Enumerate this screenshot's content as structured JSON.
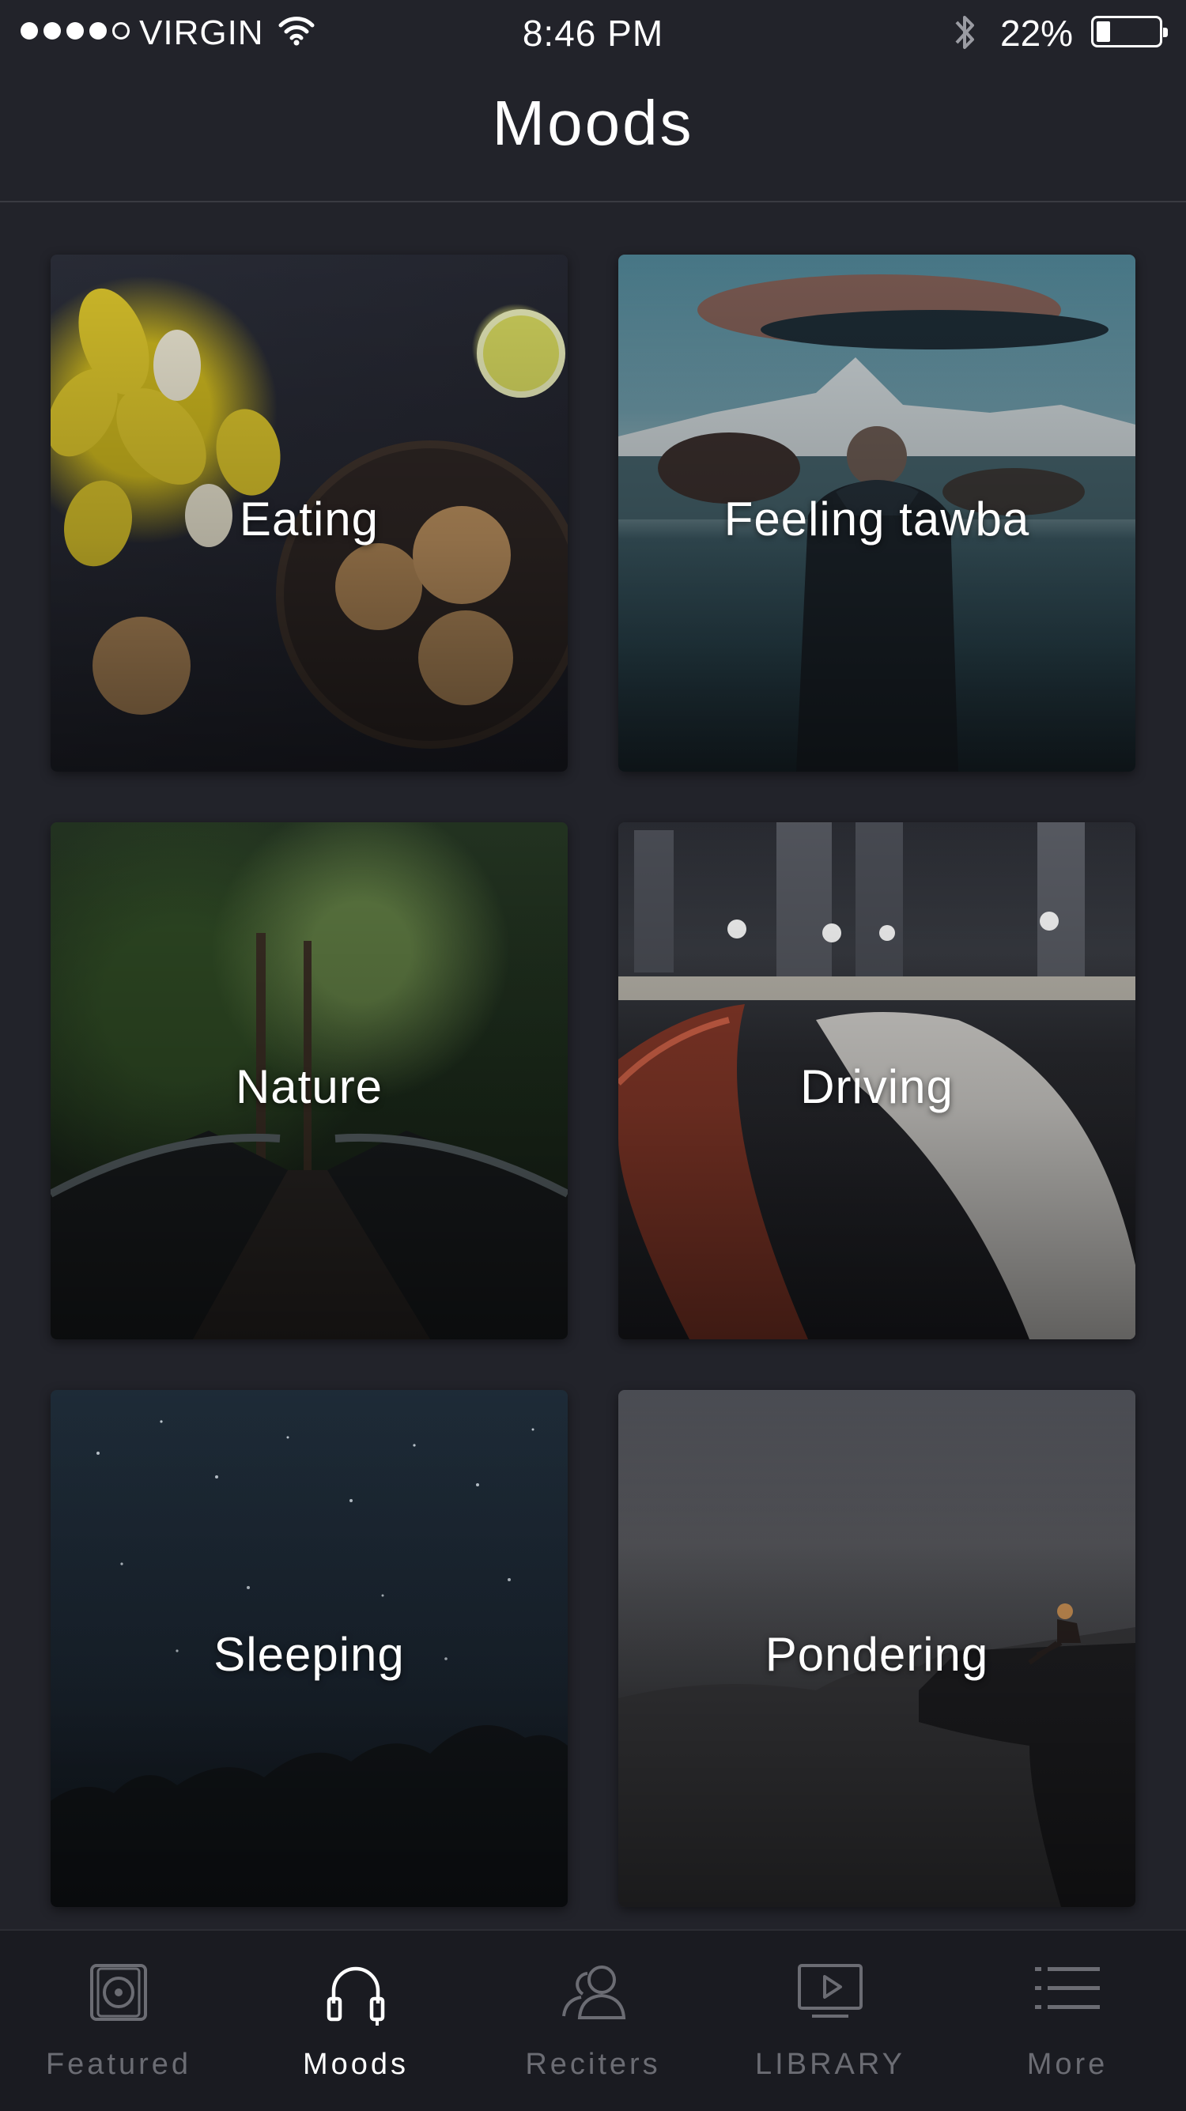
{
  "status_bar": {
    "carrier": "VIRGIN",
    "time": "8:46 PM",
    "battery_percent": "22%",
    "battery_level": 0.22,
    "signal_bars_filled": 4,
    "signal_bars_total": 5
  },
  "header": {
    "title": "Moods"
  },
  "moods": [
    {
      "label": "Eating"
    },
    {
      "label": "Feeling tawba"
    },
    {
      "label": "Nature"
    },
    {
      "label": "Driving"
    },
    {
      "label": "Sleeping"
    },
    {
      "label": "Pondering"
    }
  ],
  "tab_bar": {
    "active": "Moods",
    "tabs": [
      {
        "label": "Featured",
        "icon": "vinyl-icon"
      },
      {
        "label": "Moods",
        "icon": "headphones-icon"
      },
      {
        "label": "Reciters",
        "icon": "people-icon"
      },
      {
        "label": "LIBRARY",
        "icon": "play-screen-icon"
      },
      {
        "label": "More",
        "icon": "list-icon"
      }
    ]
  },
  "colors": {
    "background": "#22232a",
    "tab_bar": "#1a1b21",
    "active_tab": "#ffffff",
    "inactive_tab": "#6b6c73"
  }
}
